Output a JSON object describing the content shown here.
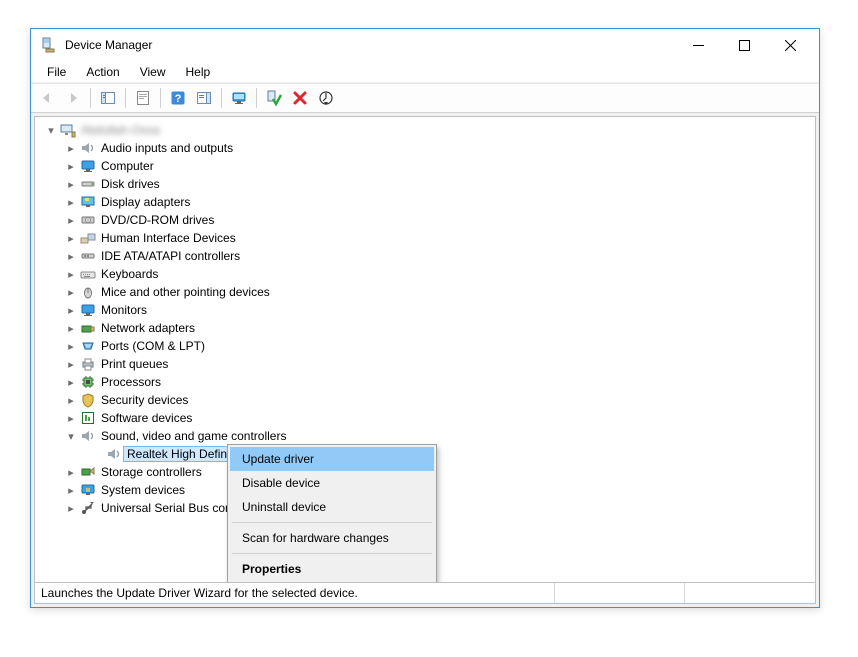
{
  "window": {
    "title": "Device Manager"
  },
  "menu": {
    "file": "File",
    "action": "Action",
    "view": "View",
    "help": "Help"
  },
  "tree": {
    "root": "Abdullah-Ossa",
    "nodes": {
      "audio": "Audio inputs and outputs",
      "computer": "Computer",
      "disk": "Disk drives",
      "display": "Display adapters",
      "dvd": "DVD/CD-ROM drives",
      "hid": "Human Interface Devices",
      "ide": "IDE ATA/ATAPI controllers",
      "keyboards": "Keyboards",
      "mice": "Mice and other pointing devices",
      "monitors": "Monitors",
      "network": "Network adapters",
      "ports": "Ports (COM & LPT)",
      "print": "Print queues",
      "processors": "Processors",
      "security": "Security devices",
      "software": "Software devices",
      "sound": "Sound, video and game controllers",
      "realtek": "Realtek High Definition Audio",
      "storage": "Storage controllers",
      "system": "System devices",
      "usb": "Universal Serial Bus controllers"
    }
  },
  "context_menu": {
    "update": "Update driver",
    "disable": "Disable device",
    "uninstall": "Uninstall device",
    "scan": "Scan for hardware changes",
    "properties": "Properties"
  },
  "status": {
    "text": "Launches the Update Driver Wizard for the selected device."
  }
}
